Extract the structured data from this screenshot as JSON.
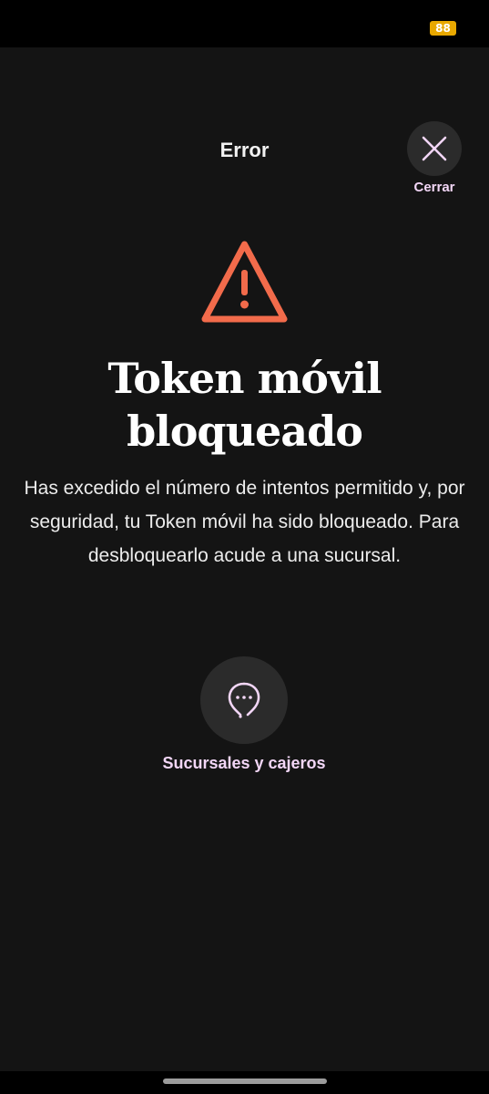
{
  "status_bar": {
    "battery_level": "88",
    "battery_color": "#e8a800"
  },
  "header": {
    "title": "Error",
    "close_label": "Cerrar",
    "close_icon": "close-icon"
  },
  "alert": {
    "icon": "warning-triangle-icon",
    "icon_color": "#f26b4b",
    "headline_line1": "Token móvil",
    "headline_line2": "bloqueado",
    "description": "Has excedido el número de intentos permitido y, por seguridad, tu Token móvil ha sido bloqueado. Para desbloquearlo acude a una sucursal."
  },
  "actions": {
    "branches_label": "Sucursales y cajeros",
    "branches_icon": "location-pin-icon",
    "accent_color": "#f2d6f6"
  }
}
